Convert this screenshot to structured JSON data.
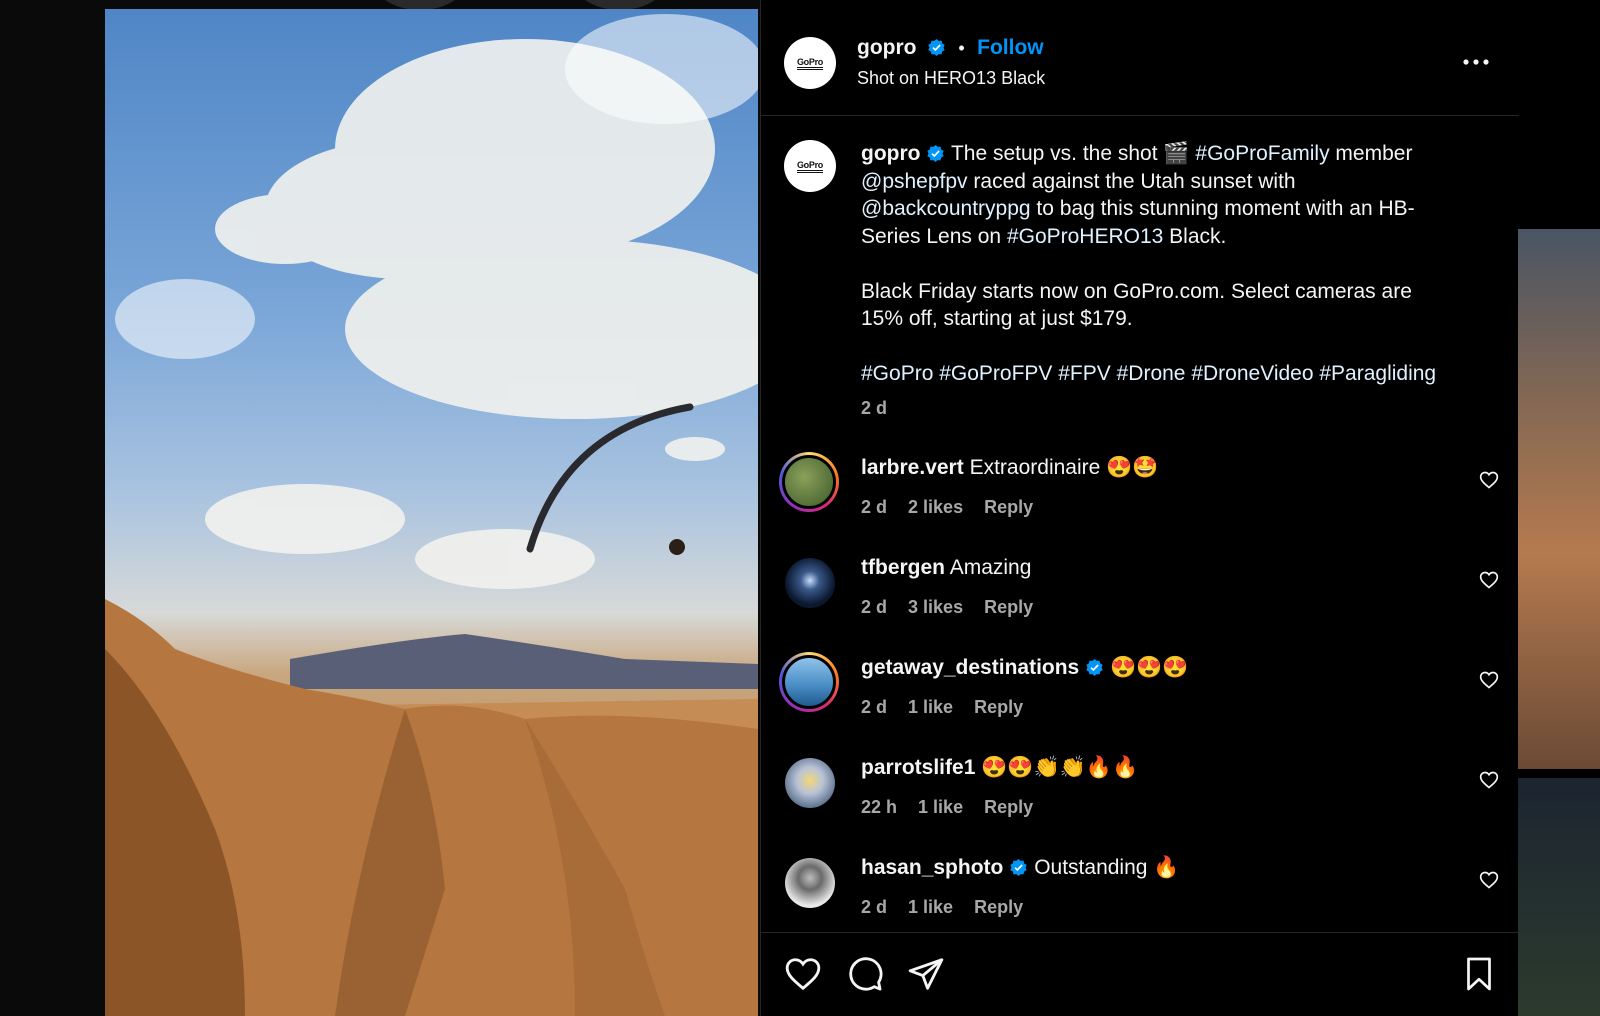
{
  "post": {
    "author": "gopro",
    "follow_label": "Follow",
    "separator": "•",
    "subtitle": "Shot on HERO13 Black",
    "avatar_logo": "GoPro",
    "more_icon": "more-horizontal-icon"
  },
  "caption": {
    "author": "gopro",
    "text_before": "The setup vs. the shot 🎬 ",
    "tag1": "#GoProFamily",
    "text_after_tag1": " member",
    "mention1": "@pshepfpv",
    "text_after_mention1": " raced against the Utah sunset with",
    "mention2": "@backcountryppg",
    "text_after_mention2": " to bag this stunning moment with an HB-",
    "line4_start": "Series Lens on ",
    "tag2": "#GoProHERO13",
    "line4_end": " Black.",
    "para2_line1": "Black Friday starts now on GoPro.com. Select cameras are",
    "para2_line2": "15% off, starting at just $179.",
    "hashtags": "#GoPro #GoProFPV #FPV #Drone #DroneVideo #Paragliding",
    "time": "2 d"
  },
  "comments": [
    {
      "user": "larbre.vert",
      "text": "Extraordinaire 😍🤩",
      "time": "2 d",
      "likes": "2 likes",
      "reply": "Reply",
      "verified": false
    },
    {
      "user": "tfbergen",
      "text": "Amazing",
      "time": "2 d",
      "likes": "3 likes",
      "reply": "Reply",
      "verified": false
    },
    {
      "user": "getaway_destinations",
      "text": "😍😍😍",
      "time": "2 d",
      "likes": "1 like",
      "reply": "Reply",
      "verified": true
    },
    {
      "user": "parrotslife1",
      "text": "😍😍👏👏🔥🔥",
      "time": "22 h",
      "likes": "1 like",
      "reply": "Reply",
      "verified": false
    },
    {
      "user": "hasan_sphoto",
      "text": "Outstanding 🔥",
      "time": "2 d",
      "likes": "1 like",
      "reply": "Reply",
      "verified": true
    }
  ],
  "actions": {
    "like_icon": "heart-icon",
    "comment_icon": "comment-icon",
    "share_icon": "send-icon",
    "save_icon": "bookmark-icon"
  },
  "colors": {
    "accent": "#0095f6",
    "link": "#e0f1ff",
    "muted": "#a8a8a8",
    "background": "#000000"
  }
}
